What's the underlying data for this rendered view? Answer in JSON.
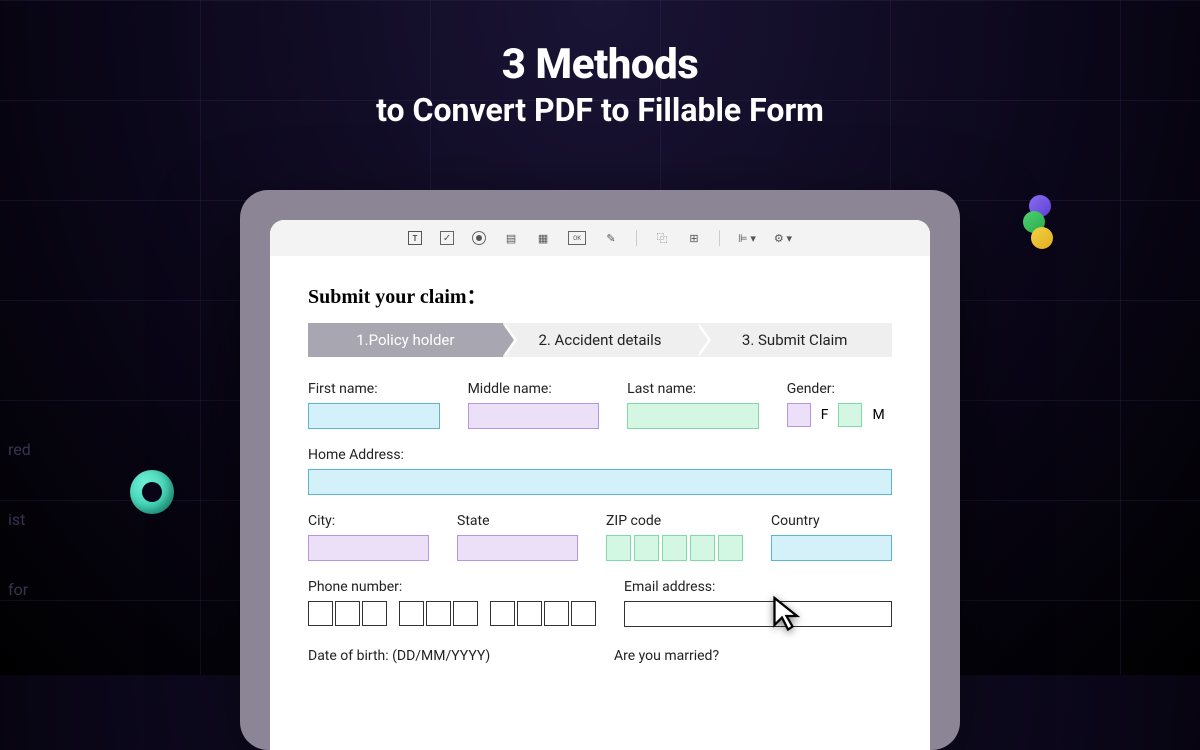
{
  "title": {
    "line1": "3 Methods",
    "line2": "to Convert PDF to Fillable Form"
  },
  "form": {
    "heading": "Submit your claim：",
    "steps": [
      "1.Policy holder",
      "2. Accident details",
      "3. Submit Claim"
    ],
    "labels": {
      "first_name": "First name:",
      "middle_name": "Middle name:",
      "last_name": "Last name:",
      "gender": "Gender:",
      "gender_f": "F",
      "gender_m": "M",
      "home_address": "Home Address:",
      "city": "City:",
      "state": "State",
      "zip": "ZIP code",
      "country": "Country",
      "phone": "Phone number:",
      "email": "Email address:",
      "dob": "Date of birth: (DD/MM/YYYY)",
      "married": "Are you married?"
    }
  },
  "side_text": [
    "red",
    "ist",
    "for"
  ]
}
